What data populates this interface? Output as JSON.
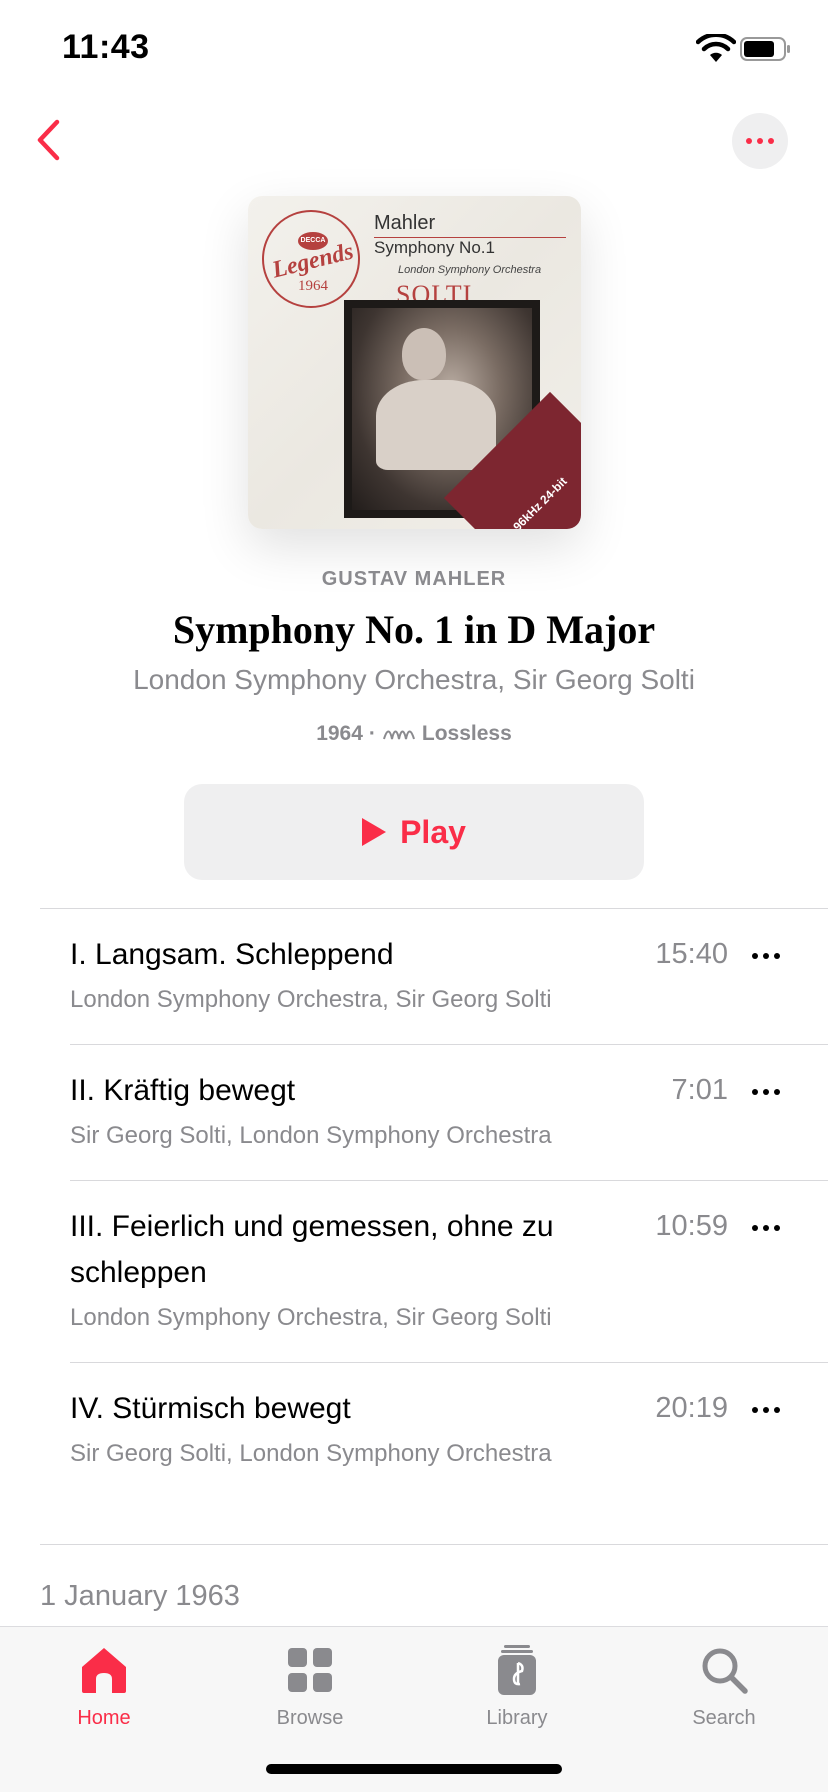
{
  "status_bar": {
    "time": "11:43"
  },
  "album": {
    "artist": "GUSTAV MAHLER",
    "title": "Symphony No. 1 in D Major",
    "subtitle": "London Symphony Orchestra, Sir Georg Solti",
    "year": "1964",
    "separator": "·",
    "quality": "Lossless",
    "artwork": {
      "composer": "Mahler",
      "work": "Symphony No.1",
      "orchestra": "London Symphony Orchestra",
      "conductor": "SOLTI",
      "label": "DECCA",
      "series": "Legends",
      "series_year": "1964",
      "corner": "96kHz 24-bit"
    }
  },
  "play_button": {
    "label": "Play"
  },
  "tracks": [
    {
      "title": "I. Langsam. Schleppend",
      "artists": "London Symphony Orchestra, Sir Georg Solti",
      "duration": "15:40"
    },
    {
      "title": "II. Kräftig bewegt",
      "artists": "Sir Georg Solti, London Symphony Orchestra",
      "duration": "7:01"
    },
    {
      "title": "III. Feierlich und gemessen, ohne zu schleppen",
      "artists": "London Symphony Orchestra, Sir Georg Solti",
      "duration": "10:59"
    },
    {
      "title": "IV. Stürmisch bewegt",
      "artists": "Sir Georg Solti, London Symphony Orchestra",
      "duration": "20:19"
    }
  ],
  "release_date": "1 January 1963",
  "tab_bar": {
    "tabs": [
      {
        "label": "Home",
        "icon": "home-icon",
        "active": true
      },
      {
        "label": "Browse",
        "icon": "browse-grid-icon",
        "active": false
      },
      {
        "label": "Library",
        "icon": "library-icon",
        "active": false
      },
      {
        "label": "Search",
        "icon": "search-icon",
        "active": false
      }
    ]
  },
  "colors": {
    "accent": "#fa2d48",
    "secondary_text": "#8a8a8e",
    "button_bg": "#efeff0"
  }
}
